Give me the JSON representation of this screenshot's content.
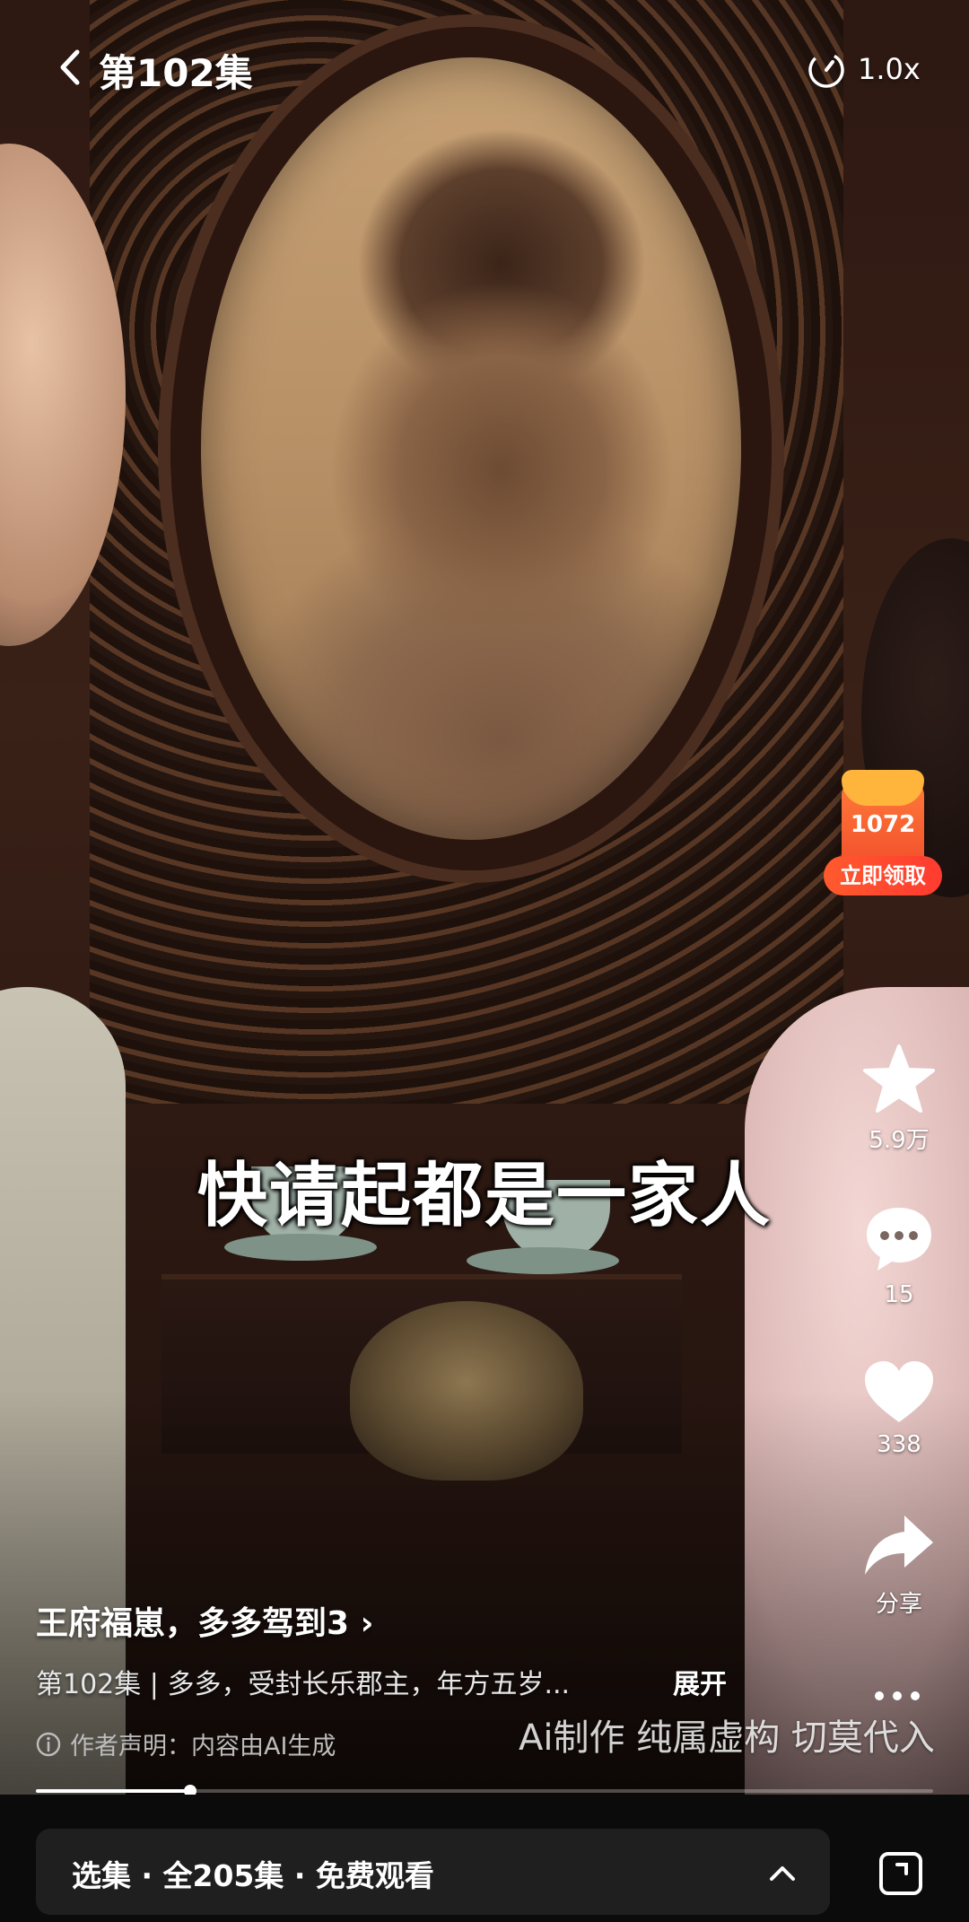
{
  "header": {
    "back_icon": "chevron-left-icon",
    "episode_title": "第102集",
    "speed_icon": "speed-timer-icon",
    "speed_label": "1.0x"
  },
  "subtitle": "快请起都是一家人",
  "red_packet": {
    "count": "1072",
    "claim_label": "立即领取",
    "colors": {
      "envelope": "#f04a2a",
      "lid": "#ffb43c"
    }
  },
  "actions": {
    "collect": {
      "icon": "star-icon",
      "count": "5.9万"
    },
    "comment": {
      "icon": "comment-bubble-icon",
      "count": "15"
    },
    "like": {
      "icon": "heart-icon",
      "count": "338"
    },
    "share": {
      "icon": "share-arrow-icon",
      "label": "分享"
    },
    "more_icon": "more-dots-icon"
  },
  "info": {
    "series_link": "王府福崽，多多驾到3 ›",
    "episode_desc": "第102集 | 多多，受封长乐郡主，年方五岁...",
    "expand_label": "展开",
    "disclaimer": "作者声明：内容由AI生成",
    "watermark": "Ai制作 纯属虚构 切莫代入"
  },
  "progress": {
    "played_fraction": 0.172
  },
  "bottom_bar": {
    "picker_label": "选集 · 全205集 · 免费观看",
    "picker_icon": "chevron-up-icon",
    "fullscreen_icon": "fullscreen-icon"
  }
}
